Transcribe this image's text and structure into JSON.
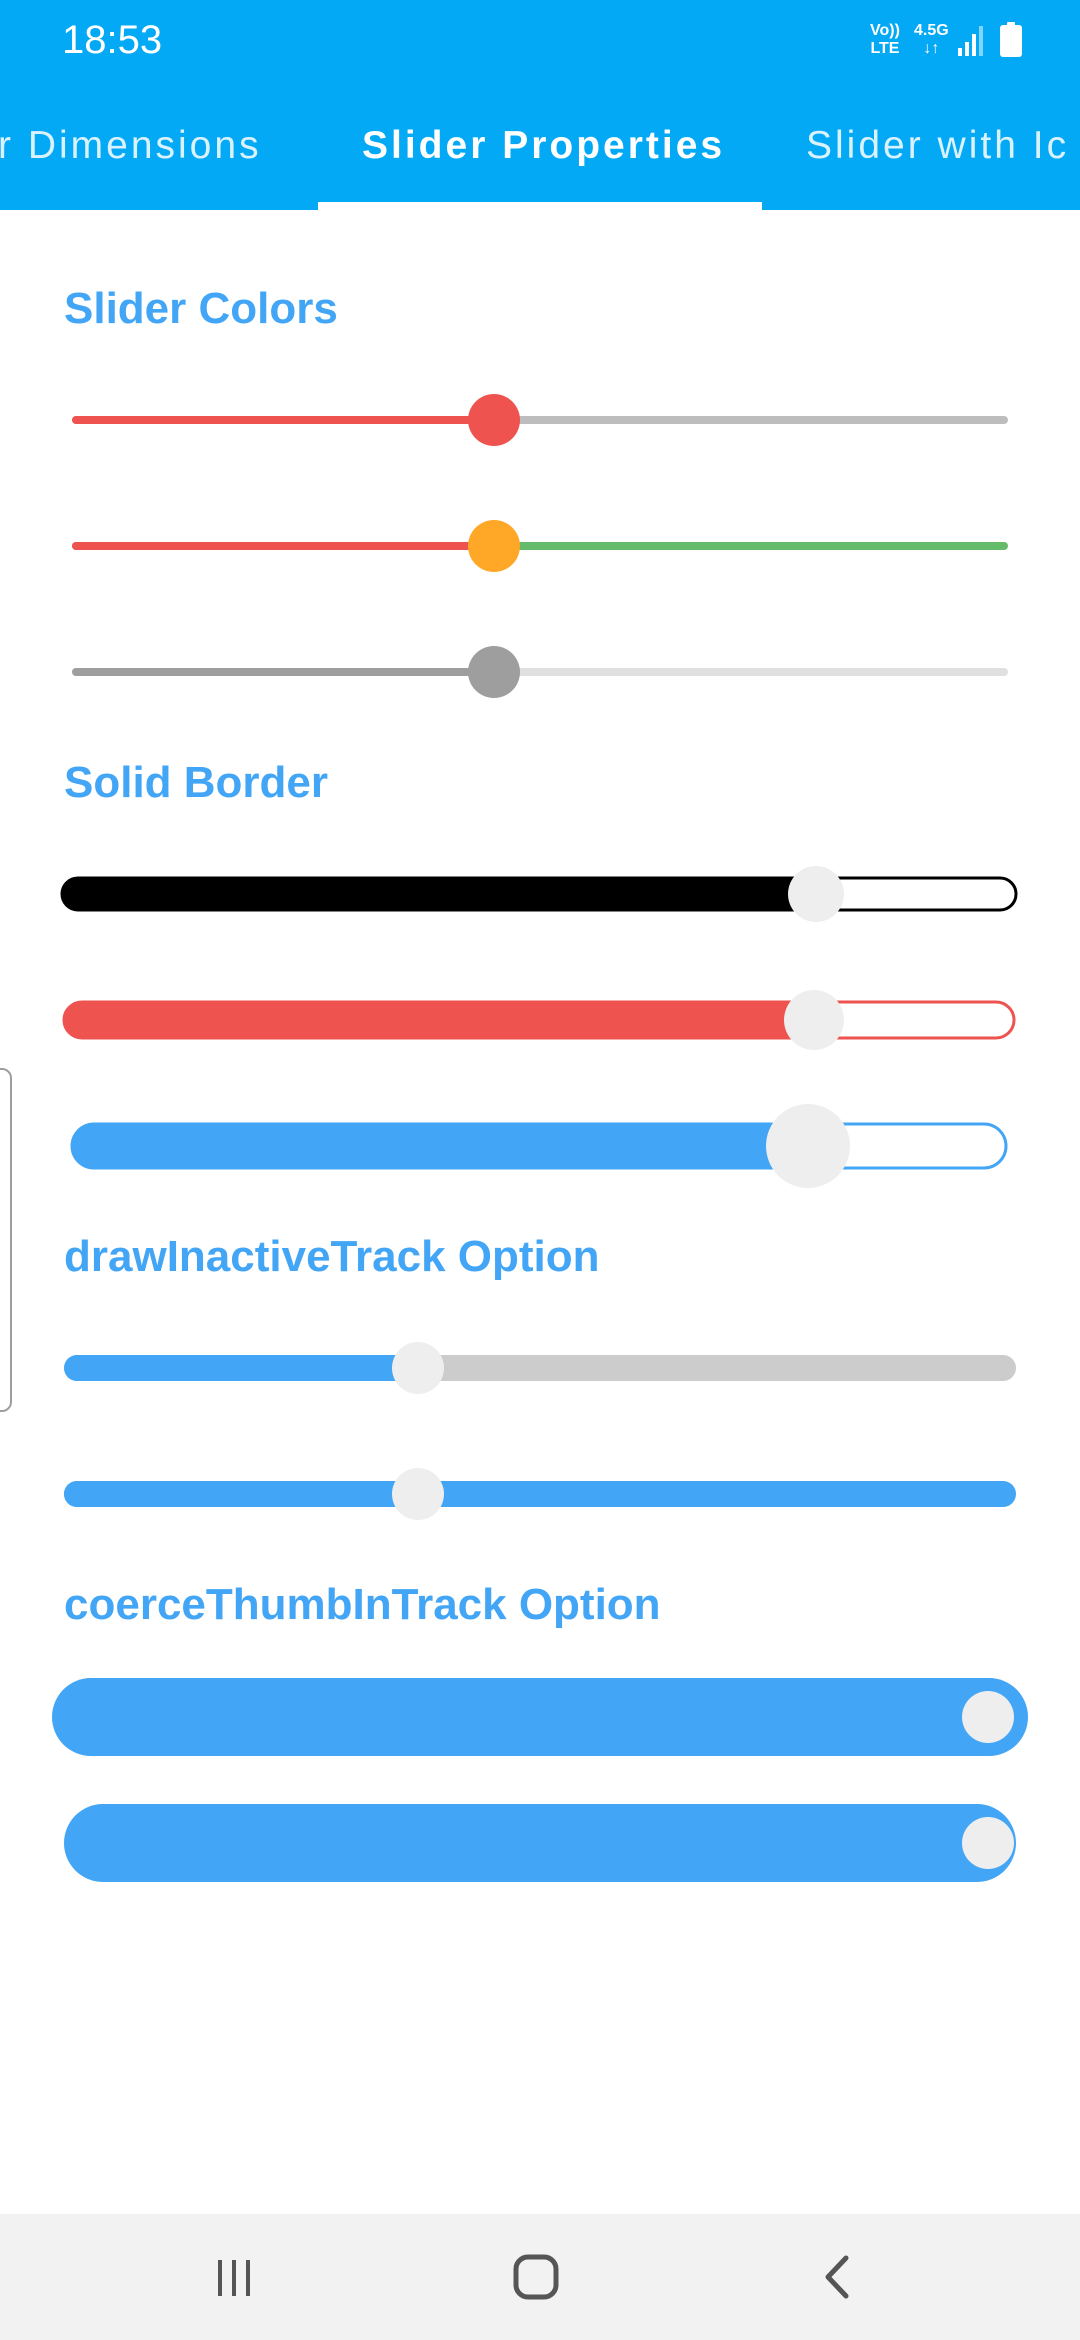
{
  "status_bar": {
    "time": "18:53",
    "network_top": "Vo))",
    "network_bottom": "LTE",
    "speed_top": "4.5G",
    "speed_bottom": "↓↑",
    "icons": [
      "signal-icon",
      "battery-icon"
    ]
  },
  "tabs": [
    {
      "label": "Slider Dimensions",
      "visible_text": "r Dimensions",
      "active": false
    },
    {
      "label": "Slider Properties",
      "visible_text": "Slider Properties",
      "active": true
    },
    {
      "label": "Slider with Icons",
      "visible_text": "Slider with Ic",
      "active": false
    }
  ],
  "colors": {
    "app_bar": "#03A9F4",
    "heading": "#42A5F5",
    "red": "#EF5350",
    "grey_inactive": "#BDBDBD",
    "orange": "#FFA726",
    "green": "#66BB6A",
    "dark_grey": "#9E9E9E",
    "light_grey": "#E0E0E0",
    "blue": "#42A5F5",
    "black": "#000000",
    "thumb_light": "#EEEEEE"
  },
  "sections": {
    "slider_colors": {
      "title": "Slider Colors",
      "sliders": [
        {
          "value": 0.45,
          "active": "#EF5350",
          "inactive": "#BDBDBD",
          "thumb": "#EF5350"
        },
        {
          "value": 0.45,
          "active": "#EF5350",
          "inactive": "#66BB6A",
          "thumb": "#FFA726"
        },
        {
          "value": 0.45,
          "active": "#9E9E9E",
          "inactive": "#E0E0E0",
          "thumb": "#9E9E9E"
        }
      ]
    },
    "solid_border": {
      "title": "Solid Border",
      "sliders": [
        {
          "value": 0.8,
          "active": "#000000",
          "border": "#000000",
          "thumb": "#EEEEEE"
        },
        {
          "value": 0.8,
          "active": "#EF5350",
          "border": "#EF5350",
          "thumb": "#EEEEEE"
        },
        {
          "value": 0.79,
          "active": "#42A5F5",
          "border": "#42A5F5",
          "thumb": "#EEEEEE"
        }
      ]
    },
    "draw_inactive_track": {
      "title": "drawInactiveTrack Option",
      "sliders": [
        {
          "value": 0.37,
          "active": "#42A5F5",
          "inactive": "#CCCCCC",
          "thumb": "#EEEEEE"
        },
        {
          "value": 0.37,
          "active": "#42A5F5",
          "inactive": "#42A5F5",
          "thumb": "#EEEEEE"
        }
      ]
    },
    "coerce_thumb_in_track": {
      "title": "coerceThumbInTrack Option",
      "sliders": [
        {
          "value": 1.0,
          "active": "#42A5F5",
          "thumb": "#EEEEEE"
        },
        {
          "value": 1.0,
          "active": "#42A5F5",
          "thumb": "#EEEEEE"
        }
      ]
    }
  },
  "nav_bar": {
    "buttons": [
      "recent-apps-icon",
      "home-icon",
      "back-icon"
    ]
  }
}
